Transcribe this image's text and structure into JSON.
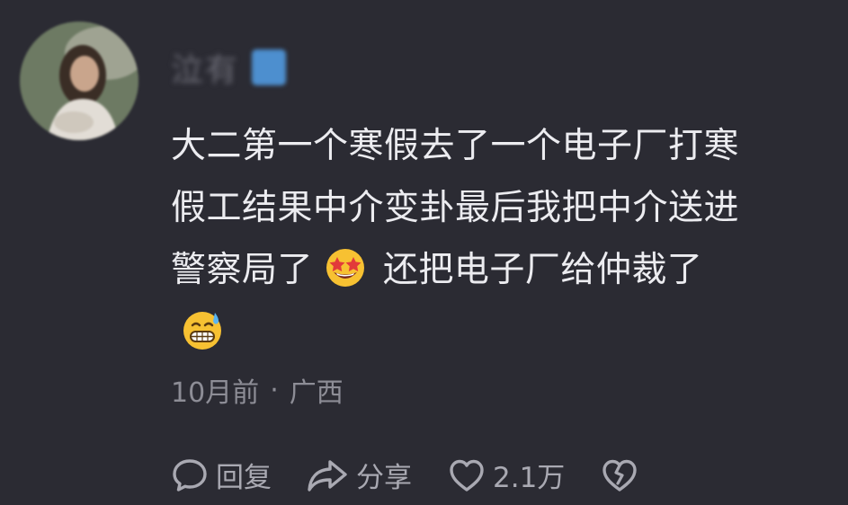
{
  "comment": {
    "username": "泣有",
    "lines": [
      "大二第一个寒假去了一个电子厂打寒",
      "假工结果中介变卦最后我把中介送进",
      "警察局了"
    ],
    "line3_rest": "还把电子厂给仲裁了",
    "emoji1": "star-struck-emoji",
    "emoji2": "grinning-sweat-emoji",
    "time": "10月前",
    "separator": "·",
    "location": "广西"
  },
  "actions": {
    "reply_label": "回复",
    "share_label": "分享",
    "like_count": "2.1万"
  },
  "colors": {
    "background": "#2b2b33",
    "text": "#ececf0",
    "meta": "#8d8d96",
    "action": "#a9a9b2",
    "badge": "#4d8fcf"
  }
}
